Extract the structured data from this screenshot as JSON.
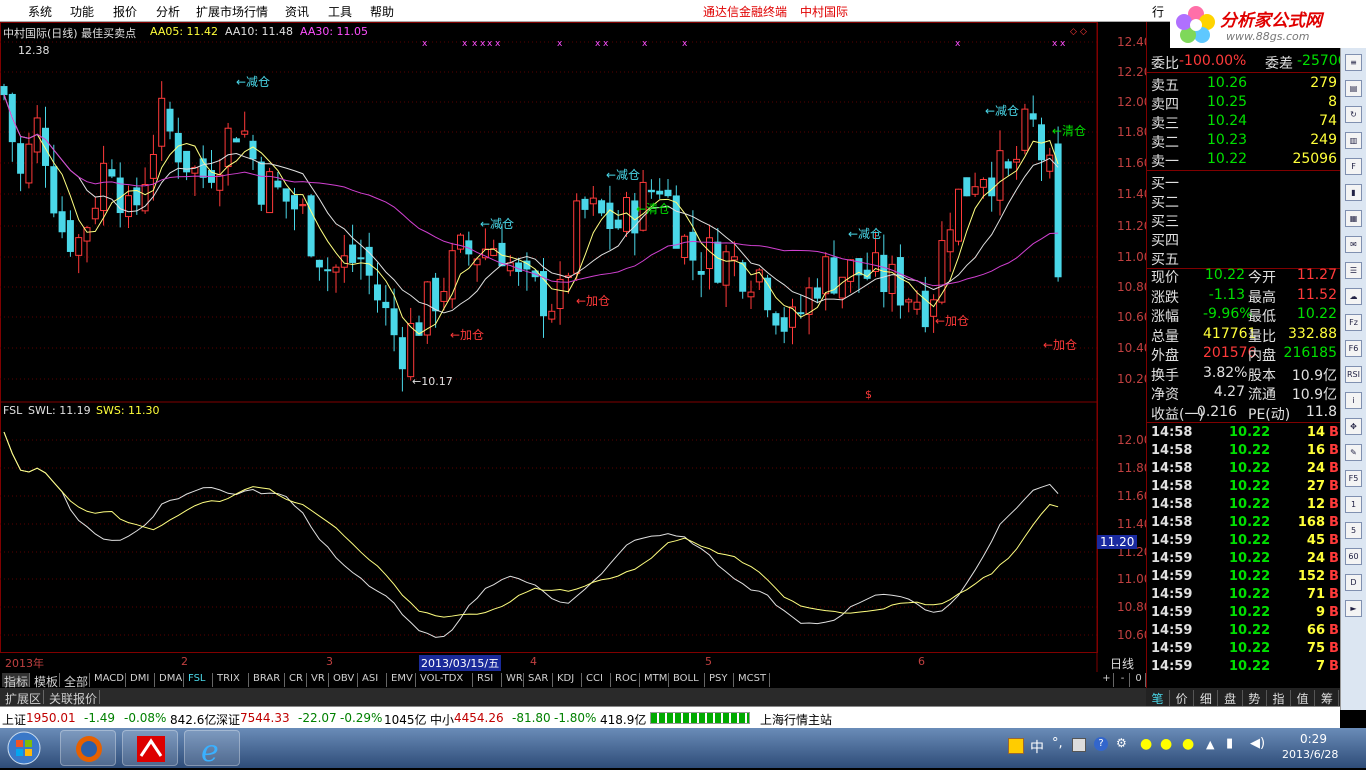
{
  "menu": [
    "系统",
    "功能",
    "报价",
    "分析",
    "扩展市场行情",
    "资讯",
    "工具",
    "帮助"
  ],
  "menu_right": [
    "通达信金融终端",
    "中村国际"
  ],
  "menu_side": "行",
  "logo": {
    "main": "分析家公式网",
    "sub": "www.88gs.com"
  },
  "chart": {
    "header": {
      "title": "中村国际(日线) 最佳买卖点",
      "aa05": "AA05: 11.42",
      "aa10": "AA10: 11.48",
      "aa30": "AA30: 11.05"
    },
    "hi_label": "12.38",
    "lo_label": "←10.17",
    "dollar": "$",
    "y_ticks": [
      "12.40",
      "12.20",
      "12.00",
      "11.80",
      "11.60",
      "11.40",
      "11.20",
      "11.00",
      "10.80",
      "10.60",
      "10.40",
      "10.20"
    ],
    "sub_header": {
      "name": "FSL",
      "swl": "SWL: 11.19",
      "sws": "SWS: 11.30"
    },
    "sub_y_ticks": [
      "12.00",
      "11.80",
      "11.60",
      "11.40",
      "11.20",
      "11.00",
      "10.80",
      "10.60"
    ],
    "sub_cursor": "11.20",
    "x_labels": [
      "2013年",
      "2",
      "3",
      "2013/03/15/五",
      "4",
      "5",
      "6"
    ],
    "period": "日线",
    "annotations": [
      {
        "text": "←减仓",
        "color": "#4ad7e8"
      },
      {
        "text": "←减仓",
        "color": "#4ad7e8"
      },
      {
        "text": "←减仓",
        "color": "#4ad7e8"
      },
      {
        "text": "←减仓",
        "color": "#4ad7e8"
      },
      {
        "text": "←减仓",
        "color": "#4ad7e8"
      },
      {
        "text": "←清仓",
        "color": "#00e000"
      },
      {
        "text": "←清仓",
        "color": "#00e000"
      },
      {
        "text": "←加仓",
        "color": "#ff3a3a"
      },
      {
        "text": "←加仓",
        "color": "#ff3a3a"
      },
      {
        "text": "←加仓",
        "color": "#ff3a3a"
      },
      {
        "text": "←加仓",
        "color": "#ff3a3a"
      }
    ]
  },
  "tabs": [
    "指标",
    "模板",
    "全部",
    "MACD",
    "DMI",
    "DMA",
    "FSL",
    "TRIX",
    "BRAR",
    "CR",
    "VR",
    "OBV",
    "ASI",
    "EMV",
    "VOL-TDX",
    "RSI",
    "WR",
    "SAR",
    "KDJ",
    "CCI",
    "ROC",
    "MTM",
    "BOLL",
    "PSY",
    "MCST"
  ],
  "tab_controls": [
    "+",
    "-",
    "0"
  ],
  "tabs2": [
    "扩展区",
    "关联报价"
  ],
  "quote": {
    "header": {
      "wb_label": "委比",
      "wb_value": "-100.00%",
      "wc_label": "委差",
      "wc_value": "-25706"
    },
    "sell": [
      {
        "label": "卖五",
        "price": "10.26",
        "vol": "279"
      },
      {
        "label": "卖四",
        "price": "10.25",
        "vol": "8"
      },
      {
        "label": "卖三",
        "price": "10.24",
        "vol": "74"
      },
      {
        "label": "卖二",
        "price": "10.23",
        "vol": "249"
      },
      {
        "label": "卖一",
        "price": "10.22",
        "vol": "25096"
      }
    ],
    "buy": [
      "买一",
      "买二",
      "买三",
      "买四",
      "买五"
    ],
    "stats": [
      {
        "l1": "现价",
        "v1": "10.22",
        "l2": "今开",
        "v2": "11.27"
      },
      {
        "l1": "涨跌",
        "v1": "-1.13",
        "l2": "最高",
        "v2": "11.52"
      },
      {
        "l1": "涨幅",
        "v1": "-9.96%",
        "l2": "最低",
        "v2": "10.22"
      },
      {
        "l1": "总量",
        "v1": "417761",
        "l2": "量比",
        "v2": "332.88"
      },
      {
        "l1": "外盘",
        "v1": "201576",
        "l2": "内盘",
        "v2": "216185"
      },
      {
        "l1": "换手",
        "v1": "3.82%",
        "l2": "股本",
        "v2": "10.9亿"
      },
      {
        "l1": "净资",
        "v1": "4.27",
        "l2": "流通",
        "v2": "10.9亿"
      },
      {
        "l1": "收益(一)",
        "v1": "0.216",
        "l2": "PE(动)",
        "v2": "11.8"
      }
    ],
    "ticks": [
      {
        "t": "14:58",
        "p": "10.22",
        "v": "14",
        "s": "B"
      },
      {
        "t": "14:58",
        "p": "10.22",
        "v": "16",
        "s": "B"
      },
      {
        "t": "14:58",
        "p": "10.22",
        "v": "24",
        "s": "B"
      },
      {
        "t": "14:58",
        "p": "10.22",
        "v": "27",
        "s": "B"
      },
      {
        "t": "14:58",
        "p": "10.22",
        "v": "12",
        "s": "B"
      },
      {
        "t": "14:58",
        "p": "10.22",
        "v": "168",
        "s": "B"
      },
      {
        "t": "14:59",
        "p": "10.22",
        "v": "45",
        "s": "B"
      },
      {
        "t": "14:59",
        "p": "10.22",
        "v": "24",
        "s": "B"
      },
      {
        "t": "14:59",
        "p": "10.22",
        "v": "152",
        "s": "B"
      },
      {
        "t": "14:59",
        "p": "10.22",
        "v": "71",
        "s": "B"
      },
      {
        "t": "14:59",
        "p": "10.22",
        "v": "9",
        "s": "B"
      },
      {
        "t": "14:59",
        "p": "10.22",
        "v": "66",
        "s": "B"
      },
      {
        "t": "14:59",
        "p": "10.22",
        "v": "75",
        "s": "B"
      },
      {
        "t": "14:59",
        "p": "10.22",
        "v": "7",
        "s": "B"
      }
    ],
    "tabs": [
      "笔",
      "价",
      "细",
      "盘",
      "势",
      "指",
      "值",
      "筹"
    ]
  },
  "status": {
    "sh_label": "上证",
    "sh_val": "1950.01",
    "sh_chg": "-1.49",
    "sh_pct": "-0.08%",
    "sh_amt": "842.6亿",
    "sz_label": "深证",
    "sz_val": "7544.33",
    "sz_chg": "-22.07",
    "sz_pct": "-0.29%",
    "sz_amt": "1045亿",
    "zx_label": "中小",
    "zx_val": "4454.26",
    "zx_chg": "-81.80",
    "zx_pct": "-1.80%",
    "zx_amt": "418.9亿",
    "server": "上海行情主站"
  },
  "taskbar": {
    "ime": "中",
    "time": "0:29",
    "date": "2013/6/28"
  },
  "chart_data": {
    "type": "candlestick",
    "price_range": [
      10.17,
      12.38
    ],
    "ma_labels": [
      "AA05",
      "AA10",
      "AA30"
    ],
    "ma_values": [
      11.42,
      11.48,
      11.05
    ],
    "indicator": {
      "name": "FSL",
      "SWL": 11.19,
      "SWS": 11.3
    }
  }
}
